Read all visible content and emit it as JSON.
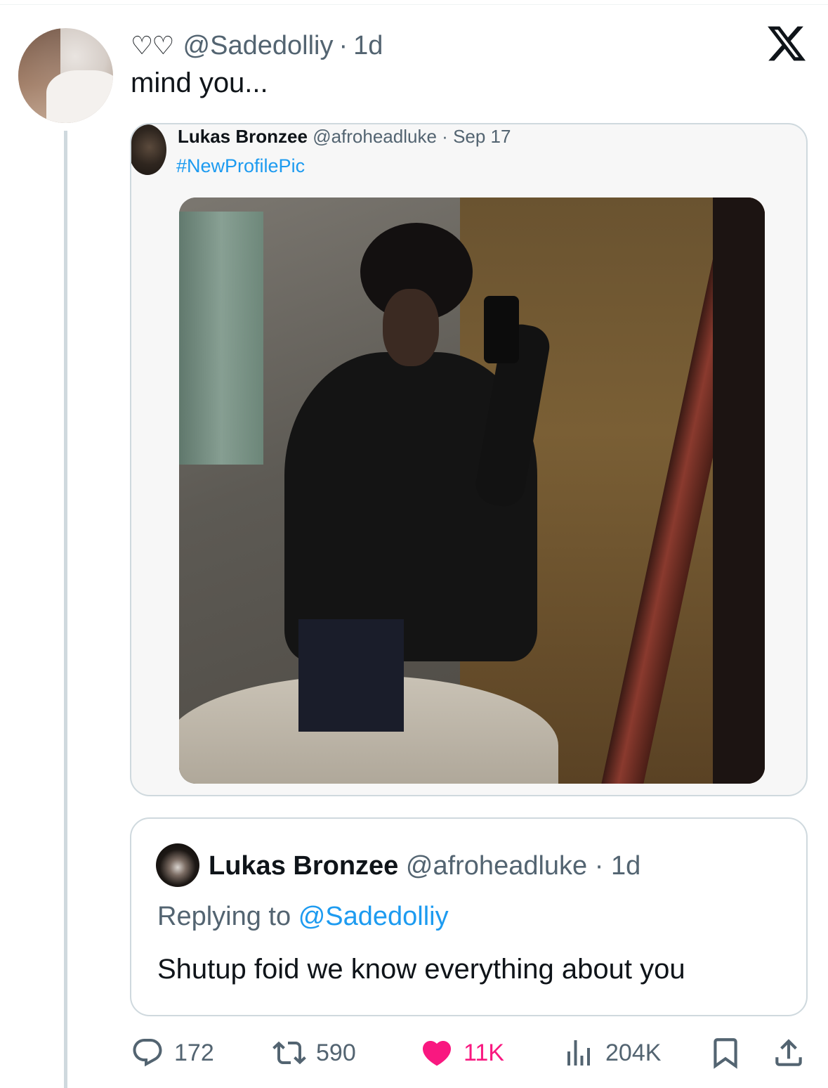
{
  "tweet": {
    "hearts": "♡♡",
    "handle": "@Sadedolliy",
    "separator": "·",
    "time": "1d",
    "text": "mind you..."
  },
  "quoted": {
    "name": "Lukas Bronzee",
    "handle": "@afroheadluke",
    "separator": "·",
    "date": "Sep 17",
    "hashtag": "#NewProfilePic"
  },
  "reply": {
    "name": "Lukas Bronzee",
    "handle": "@afroheadluke",
    "separator": "·",
    "time": "1d",
    "replying_prefix": "Replying to",
    "replying_mention": "@Sadedolliy",
    "text": "Shutup foid we know everything about you"
  },
  "actions": {
    "replies": "172",
    "retweets": "590",
    "likes": "11K",
    "views": "204K"
  },
  "icons": [
    "x-logo-icon",
    "reply-icon",
    "retweet-icon",
    "heart-icon",
    "views-icon",
    "bookmark-icon",
    "share-icon"
  ],
  "colors": {
    "accent": "#1d9bf0",
    "like": "#f91880",
    "muted": "#536471",
    "text": "#0f1419",
    "border": "#cfd9de"
  }
}
